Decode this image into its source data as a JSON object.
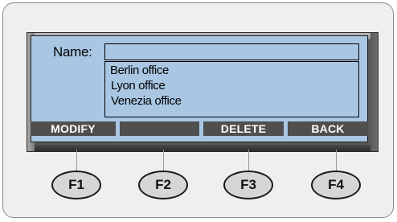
{
  "screen": {
    "name_label": "Name:",
    "name_value": "",
    "offices": [
      "Berlin office",
      "Lyon office",
      "Venezia office"
    ]
  },
  "softkeys": [
    "MODIFY",
    "",
    "DELETE",
    "BACK"
  ],
  "function_keys": [
    "F1",
    "F2",
    "F3",
    "F4"
  ],
  "colors": {
    "lcd_background": "#a9c6e3",
    "softkey_background": "#4f4f4f",
    "device_body": "#efefef"
  }
}
